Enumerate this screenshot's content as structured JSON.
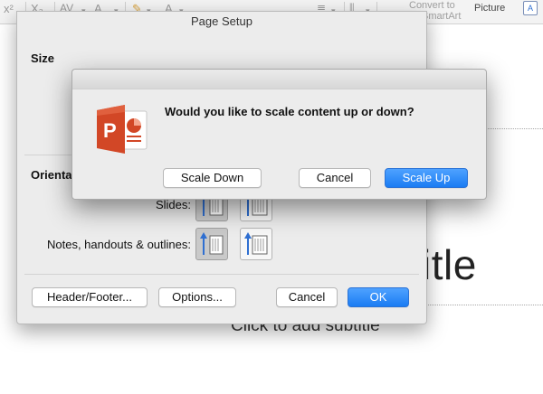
{
  "ribbon": {
    "glyphs": [
      "x²",
      "X₂",
      "AV",
      "A",
      "A"
    ],
    "convert_line1": "Convert to",
    "convert_line2": "SmartArt",
    "picture_label": "Picture",
    "textbox_glyph": "A"
  },
  "slide": {
    "title_fragment": "itle",
    "subtitle_placeholder": "Click to add subtitle"
  },
  "page_setup": {
    "title": "Page Setup",
    "size_label": "Size",
    "orientation_label": "Orientation",
    "slides_label": "Slides:",
    "notes_label": "Notes, handouts & outlines:",
    "header_footer_button": "Header/Footer...",
    "options_button": "Options...",
    "cancel_button": "Cancel",
    "ok_button": "OK"
  },
  "alert": {
    "message": "Would you like to scale content up or down?",
    "scale_down_button": "Scale Down",
    "cancel_button": "Cancel",
    "scale_up_button": "Scale Up",
    "icon": "powerpoint-app-icon"
  },
  "colors": {
    "primary_button": "#1a7cf3",
    "powerpoint_orange": "#d24726"
  }
}
